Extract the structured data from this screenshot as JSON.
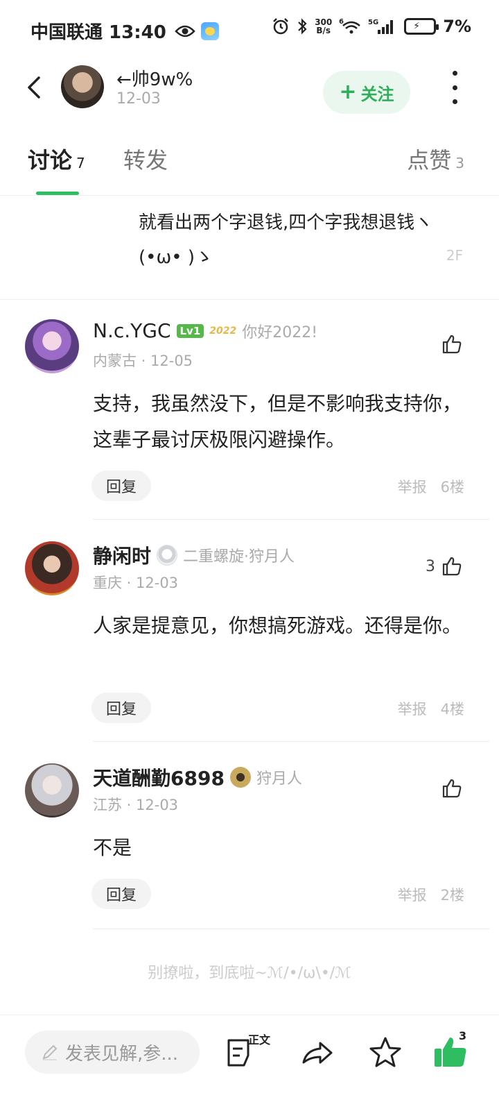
{
  "status_bar": {
    "carrier_time": "中国联通 13:40",
    "net_speed_value": "300",
    "net_speed_unit": "B/s",
    "wifi_sup": "6",
    "signal_sup": "5G",
    "battery": "7%"
  },
  "header": {
    "username": "←帅9w%",
    "date": "12-03",
    "follow_label": "关注",
    "follow_plus": "+"
  },
  "tabs": {
    "discuss_label": "讨论",
    "discuss_count": "7",
    "forward_label": "转发",
    "likes_label": "点赞",
    "likes_count": "3"
  },
  "partial_comment": {
    "text": "就看出两个字退钱,四个字我想退钱ヽ(•ω• )ゝ",
    "floor": "2F"
  },
  "comments": [
    {
      "name": "N.c.YGC",
      "level_badge": "Lv1",
      "year_badge": "2022",
      "tag": "你好2022!",
      "meta": "内蒙古 · 12-05",
      "likes": "",
      "body": "支持，我虽然没下，但是不影响我支持你，这辈子最讨厌极限闪避操作。",
      "reply_label": "回复",
      "report_label": "举报",
      "floor": "6楼"
    },
    {
      "name": "静闲时",
      "tag": "二重螺旋·狩月人",
      "meta": "重庆 · 12-03",
      "likes": "3",
      "body": "人家是提意见，你想搞死游戏。还得是你。",
      "reply_label": "回复",
      "report_label": "举报",
      "floor": "4楼"
    },
    {
      "name": "天道酬勤6898",
      "tag": "狩月人",
      "meta": "江苏 · 12-03",
      "likes": "",
      "body": "不是",
      "reply_label": "回复",
      "report_label": "举报",
      "floor": "2楼"
    }
  ],
  "end_text": "别撩啦，到底啦~ℳ/•/ω\\•/ℳ",
  "bottom_bar": {
    "input_placeholder": "发表见解,参...",
    "doc_label": "正文",
    "like_count": "3"
  },
  "colors": {
    "accent_green": "#2fbd62",
    "follow_bg": "#eaf7ee",
    "muted_text": "#aaaaaa"
  }
}
